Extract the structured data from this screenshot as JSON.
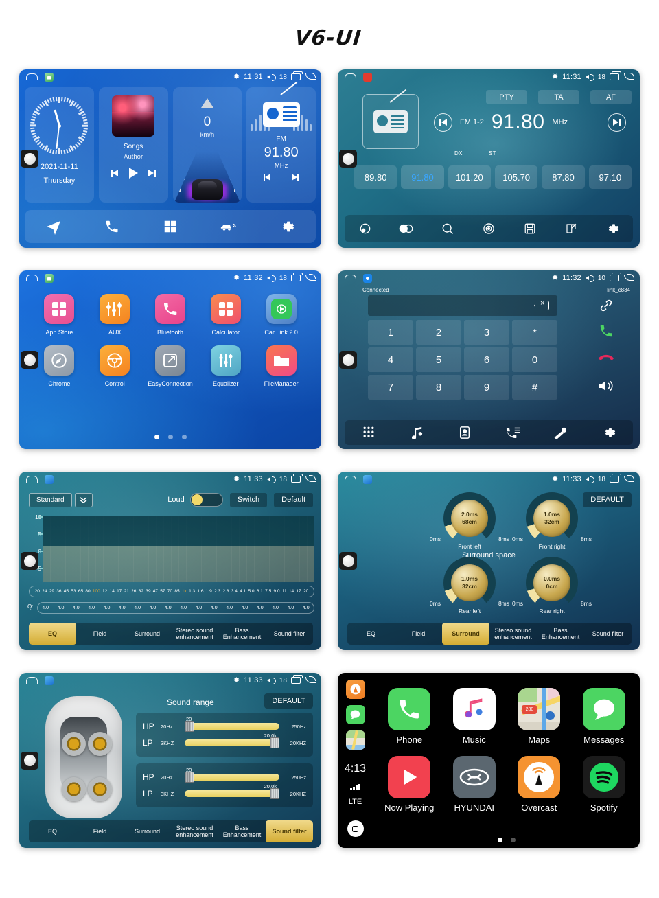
{
  "title": "V6-UI",
  "statusbar": {
    "bt_icon": "bluetooth-icon",
    "recents_icon": "recents-icon",
    "back_icon": "back-icon",
    "volume_icon": "volume-icon"
  },
  "home": {
    "time": "11:31",
    "volume": "18",
    "clock": {
      "date": "2021-11-11",
      "day": "Thursday"
    },
    "music": {
      "title": "Songs",
      "artist": "Author",
      "prev": "prev-icon",
      "play": "play-icon",
      "next": "next-icon"
    },
    "nav": {
      "speed": "0",
      "unit": "km/h"
    },
    "radio": {
      "band": "FM",
      "freq": "91.80",
      "unit": "MHz"
    },
    "dock": [
      "navigation-icon",
      "phone-icon",
      "apps-icon",
      "carplay-icon",
      "settings-icon"
    ]
  },
  "radio": {
    "time": "11:31",
    "volume": "18",
    "rds": [
      "PTY",
      "TA",
      "AF"
    ],
    "band_label": "FM 1-2",
    "frequency": "91.80",
    "unit": "MHz",
    "dx": "DX",
    "st": "ST",
    "presets": [
      {
        "freq": "89.80",
        "active": false
      },
      {
        "freq": "91.80",
        "active": true
      },
      {
        "freq": "101.20",
        "active": false
      },
      {
        "freq": "105.70",
        "active": false
      },
      {
        "freq": "87.80",
        "active": false
      },
      {
        "freq": "97.10",
        "active": false
      }
    ],
    "dock": [
      "loudness-icon",
      "stereo-icon",
      "search-icon",
      "band-scan-icon",
      "save-icon",
      "edit-icon",
      "settings-icon"
    ]
  },
  "apps": {
    "time": "11:32",
    "volume": "18",
    "items": [
      {
        "label": "App Store",
        "color": "#ee5aa0",
        "icon": "grid-icon"
      },
      {
        "label": "AUX",
        "color": "#f79a31",
        "icon": "sliders-icon"
      },
      {
        "label": "Bluetooth",
        "color": "#ee4f93",
        "icon": "phone-icon"
      },
      {
        "label": "Calculator",
        "color": "#f0644e",
        "icon": "calculator-icon"
      },
      {
        "label": "Car Link 2.0",
        "color": "#5e8ad4",
        "icon": "play-circle-icon"
      },
      {
        "label": "Chrome",
        "color": "#9aa6b4",
        "icon": "compass-icon"
      },
      {
        "label": "Control",
        "color": "#f79a31",
        "icon": "steering-wheel-icon"
      },
      {
        "label": "EasyConnection",
        "color": "#8e97a6",
        "icon": "screen-share-icon"
      },
      {
        "label": "Equalizer",
        "color": "#6ab8cf",
        "icon": "equalizer-icon"
      },
      {
        "label": "FileManager",
        "color": "#ef5580",
        "icon": "folder-icon"
      }
    ],
    "dots": [
      true,
      false,
      false
    ]
  },
  "dialer": {
    "time": "11:32",
    "volume": "10",
    "status": "Connected",
    "device": "link_c834",
    "input_value": "",
    "backspace_icon": "backspace-icon",
    "keys": [
      "1",
      "2",
      "3",
      "*",
      "4",
      "5",
      "6",
      "0",
      "7",
      "8",
      "9",
      "#"
    ],
    "side_actions": [
      "link-icon",
      "call-icon",
      "hangup-icon",
      "speaker-icon"
    ],
    "dock": [
      "keypad-icon",
      "music-icon",
      "contacts-icon",
      "call-log-icon",
      "pair-icon",
      "settings-icon"
    ]
  },
  "eq": {
    "time": "11:33",
    "volume": "18",
    "preset": "Standard",
    "dropdown_icon": "chevron-down-icon",
    "loud_label": "Loud",
    "loud_on": true,
    "switch_label": "Switch",
    "default_label": "Default",
    "y_ticks": [
      "10",
      "5",
      "0",
      "-5"
    ],
    "frequencies": [
      "20",
      "24",
      "29",
      "36",
      "45",
      "53",
      "65",
      "80",
      "100",
      "12",
      "14",
      "17",
      "21",
      "26",
      "32",
      "39",
      "47",
      "57",
      "70",
      "85",
      "1k",
      "1.3",
      "1.6",
      "1.9",
      "2.3",
      "2.8",
      "3.4",
      "4.1",
      "5.0",
      "6.1",
      "7.5",
      "9.0",
      "11",
      "14",
      "17",
      "20"
    ],
    "highlight_freqs": [
      "100",
      "1k"
    ],
    "q_label": "Q:",
    "q_values": [
      "4.0",
      "4.0",
      "4.0",
      "4.0",
      "4.0",
      "4.0",
      "4.0",
      "4.0",
      "4.0",
      "4.0",
      "4.0",
      "4.0",
      "4.0",
      "4.0",
      "4.0",
      "4.0",
      "4.0",
      "4.0"
    ],
    "tabs": [
      {
        "label": "EQ",
        "active": true
      },
      {
        "label": "Field",
        "active": false
      },
      {
        "label": "Surround",
        "active": false
      },
      {
        "label": "Stereo sound enhancement",
        "active": false
      },
      {
        "label": "Bass Enhancement",
        "active": false
      },
      {
        "label": "Sound filter",
        "active": false
      }
    ]
  },
  "surround": {
    "time": "11:33",
    "volume": "18",
    "default_label": "DEFAULT",
    "title": "Surround space",
    "knobs": [
      {
        "name": "Front left",
        "delay": "2.0ms",
        "distance": "68cm",
        "min": "0ms",
        "max": "8ms"
      },
      {
        "name": "Front right",
        "delay": "1.0ms",
        "distance": "32cm",
        "min": "0ms",
        "max": "8ms"
      },
      {
        "name": "Rear left",
        "delay": "1.0ms",
        "distance": "32cm",
        "min": "0ms",
        "max": "8ms"
      },
      {
        "name": "Rear right",
        "delay": "0.0ms",
        "distance": "0cm",
        "min": "0ms",
        "max": "8ms"
      }
    ],
    "tabs": [
      {
        "label": "EQ",
        "active": false
      },
      {
        "label": "Field",
        "active": false
      },
      {
        "label": "Surround",
        "active": true
      },
      {
        "label": "Stereo sound enhancement",
        "active": false
      },
      {
        "label": "Bass Enhancement",
        "active": false
      },
      {
        "label": "Sound filter",
        "active": false
      }
    ]
  },
  "soundfilter": {
    "time": "11:33",
    "volume": "18",
    "title": "Sound range",
    "default_label": "DEFAULT",
    "groups": [
      {
        "rows": [
          {
            "tag": "HP",
            "min": "20Hz",
            "max": "250Hz",
            "value": "20",
            "pos": "left"
          },
          {
            "tag": "LP",
            "min": "3KHZ",
            "max": "20KHZ",
            "value": "20.0k",
            "pos": "right"
          }
        ]
      },
      {
        "rows": [
          {
            "tag": "HP",
            "min": "20Hz",
            "max": "250Hz",
            "value": "20",
            "pos": "left"
          },
          {
            "tag": "LP",
            "min": "3KHZ",
            "max": "20KHZ",
            "value": "20.0k",
            "pos": "right"
          }
        ]
      }
    ],
    "tabs": [
      {
        "label": "EQ",
        "active": false
      },
      {
        "label": "Field",
        "active": false
      },
      {
        "label": "Surround",
        "active": false
      },
      {
        "label": "Stereo sound enhancement",
        "active": false
      },
      {
        "label": "Bass Enhancement",
        "active": false
      },
      {
        "label": "Sound filter",
        "active": true
      }
    ]
  },
  "carplay": {
    "time": "4:13",
    "network": "LTE",
    "side_icons": [
      "overcast-icon",
      "messages-icon",
      "maps-icon"
    ],
    "apps": [
      {
        "label": "Phone",
        "color": "#4cd562",
        "icon": "phone-icon"
      },
      {
        "label": "Music",
        "color": "#ffffff",
        "icon": "music-note-icon"
      },
      {
        "label": "Maps",
        "color": "#e8e4d8",
        "icon": "map-icon"
      },
      {
        "label": "Messages",
        "color": "#4cd562",
        "icon": "speech-bubble-icon"
      },
      {
        "label": "Now Playing",
        "color": "#f2414f",
        "icon": "play-triangle-icon"
      },
      {
        "label": "HYUNDAI",
        "color": "#5b6770",
        "icon": "hyundai-logo-icon"
      },
      {
        "label": "Overcast",
        "color": "#f59331",
        "icon": "antenna-icon"
      },
      {
        "label": "Spotify",
        "color": "#1b1b1b",
        "icon": "spotify-icon"
      }
    ],
    "dots": [
      true,
      false
    ]
  }
}
